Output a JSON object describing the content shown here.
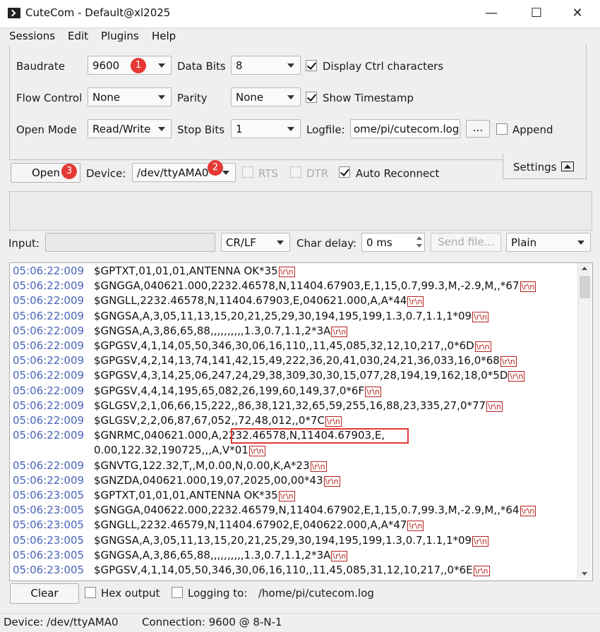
{
  "window": {
    "title": "CuteCom - Default@xl2025",
    "minimize": "—",
    "maximize": "☐",
    "close": "✕"
  },
  "menubar": {
    "items": [
      "Sessions",
      "Edit",
      "Plugins",
      "Help"
    ]
  },
  "settings": {
    "baudrate_label": "Baudrate",
    "baudrate_value": "9600",
    "databits_label": "Data Bits",
    "databits_value": "8",
    "display_ctrl_label": "Display Ctrl characters",
    "display_ctrl_checked": true,
    "flow_label": "Flow Control",
    "flow_value": "None",
    "parity_label": "Parity",
    "parity_value": "None",
    "timestamp_label": "Show Timestamp",
    "timestamp_checked": true,
    "openmode_label": "Open Mode",
    "openmode_value": "Read/Write",
    "stopbits_label": "Stop Bits",
    "stopbits_value": "1",
    "logfile_label": "Logfile:",
    "logfile_value": "ome/pi/cutecom.log",
    "browse_label": "...",
    "append_label": "Append",
    "append_checked": false,
    "tab_label": "Settings"
  },
  "connection": {
    "open_label": "Open",
    "device_label": "Device:",
    "device_value": "/dev/ttyAMA0",
    "rts_label": "RTS",
    "dtr_label": "DTR",
    "auto_reconnect_label": "Auto Reconnect",
    "auto_reconnect_checked": true
  },
  "annotations": {
    "badge1": "1",
    "badge2": "2",
    "badge3": "3"
  },
  "input_row": {
    "input_label": "Input:",
    "input_value": "",
    "line_end": "CR/LF",
    "char_delay_label": "Char delay:",
    "char_delay_value": "0 ms",
    "send_file_label": "Send file...",
    "format_value": "Plain"
  },
  "output": {
    "lines": [
      {
        "ts": "05:06:22:009",
        "msg": "$GPTXT,01,01,01,ANTENNA OK*35"
      },
      {
        "ts": "05:06:22:009",
        "msg": "$GNGGA,040621.000,2232.46578,N,11404.67903,E,1,15,0.7,99.3,M,-2.9,M,,*67"
      },
      {
        "ts": "05:06:22:009",
        "msg": "$GNGLL,2232.46578,N,11404.67903,E,040621.000,A,A*44"
      },
      {
        "ts": "05:06:22:009",
        "msg": "$GNGSA,A,3,05,11,13,15,20,21,25,29,30,194,195,199,1.3,0.7,1.1,1*09"
      },
      {
        "ts": "05:06:22:009",
        "msg": "$GNGSA,A,3,86,65,88,,,,,,,,,,1.3,0.7,1.1,2*3A"
      },
      {
        "ts": "05:06:22:009",
        "msg": "$GPGSV,4,1,14,05,50,346,30,06,16,110,,11,45,085,32,12,10,217,,0*6D"
      },
      {
        "ts": "05:06:22:009",
        "msg": "$GPGSV,4,2,14,13,74,141,42,15,49,222,36,20,41,030,24,21,36,033,16,0*68"
      },
      {
        "ts": "05:06:22:009",
        "msg": "$GPGSV,4,3,14,25,06,247,24,29,38,309,30,30,15,077,28,194,19,162,18,0*5D"
      },
      {
        "ts": "05:06:22:009",
        "msg": "$GPGSV,4,4,14,195,65,082,26,199,60,149,37,0*6F"
      },
      {
        "ts": "05:06:22:009",
        "msg": "$GLGSV,2,1,06,66,15,222,,86,38,121,32,65,59,255,16,88,23,335,27,0*77"
      },
      {
        "ts": "05:06:22:009",
        "msg": "$GLGSV,2,2,06,87,67,052,,72,48,012,,0*7C"
      },
      {
        "ts": "05:06:22:009",
        "msg": "$GNRMC,040621.000,A,2232.46578,N,11404.67903,E,"
      },
      {
        "ts": "",
        "msg": "0.00,122.32,190725,,,A,V*01"
      },
      {
        "ts": "05:06:22:009",
        "msg": "$GNVTG,122.32,T,,M,0.00,N,0.00,K,A*23"
      },
      {
        "ts": "05:06:22:009",
        "msg": "$GNZDA,040621.000,19,07,2025,00,00*43"
      },
      {
        "ts": "05:06:23:005",
        "msg": "$GPTXT,01,01,01,ANTENNA OK*35"
      },
      {
        "ts": "05:06:23:005",
        "msg": "$GNGGA,040622.000,2232.46579,N,11404.67902,E,1,15,0.7,99.3,M,-2.9,M,,*64"
      },
      {
        "ts": "05:06:23:005",
        "msg": "$GNGLL,2232.46579,N,11404.67902,E,040622.000,A,A*47"
      },
      {
        "ts": "05:06:23:005",
        "msg": "$GNGSA,A,3,05,11,13,15,20,21,25,29,30,194,195,199,1.3,0.7,1.1,1*09"
      },
      {
        "ts": "05:06:23:005",
        "msg": "$GNGSA,A,3,86,65,88,,,,,,,,,,1.3,0.7,1.1,2*3A"
      },
      {
        "ts": "05:06:23:005",
        "msg": "$GPGSV,4,1,14,05,50,346,30,06,16,110,,11,45,085,31,12,10,217,,0*6E"
      }
    ],
    "ctrl_glyph": "\\r\\n"
  },
  "bottom_bar": {
    "clear_label": "Clear",
    "hex_label": "Hex output",
    "logging_label": "Logging to:",
    "logging_path": "/home/pi/cutecom.log"
  },
  "statusbar": {
    "device": "Device:  /dev/ttyAMA0",
    "connection": "Connection:  9600 @ 8-N-1"
  },
  "colors": {
    "timestamp": "#4964b9",
    "ctrl": "#b5231f",
    "annotation": "#e53935"
  }
}
